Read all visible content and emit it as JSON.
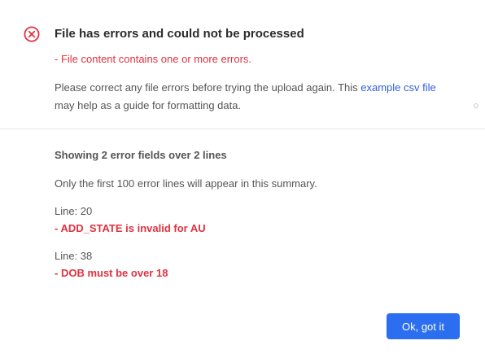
{
  "dialog": {
    "title": "File has errors and could not be processed",
    "error_summary": "- File content contains one or more errors.",
    "help": {
      "text_before_link": "Please correct any file errors before trying the upload again. This ",
      "link_label": "example csv file",
      "text_after_link": " may help as a guide for formatting data."
    },
    "icon": "error-x-circle-icon",
    "colors": {
      "error": "#e0323f",
      "link": "#2f5fd8",
      "primary_button": "#2b6ef0"
    }
  },
  "summary": {
    "showing": "Showing 2 error fields over 2 lines",
    "note": "Only the first 100 error lines will appear in this summary.",
    "errors": [
      {
        "line": "Line: 20",
        "message": "- ADD_STATE is invalid for AU"
      },
      {
        "line": "Line: 38",
        "message": "- DOB must be over 18"
      }
    ]
  },
  "actions": {
    "ok_label": "Ok, got it"
  }
}
